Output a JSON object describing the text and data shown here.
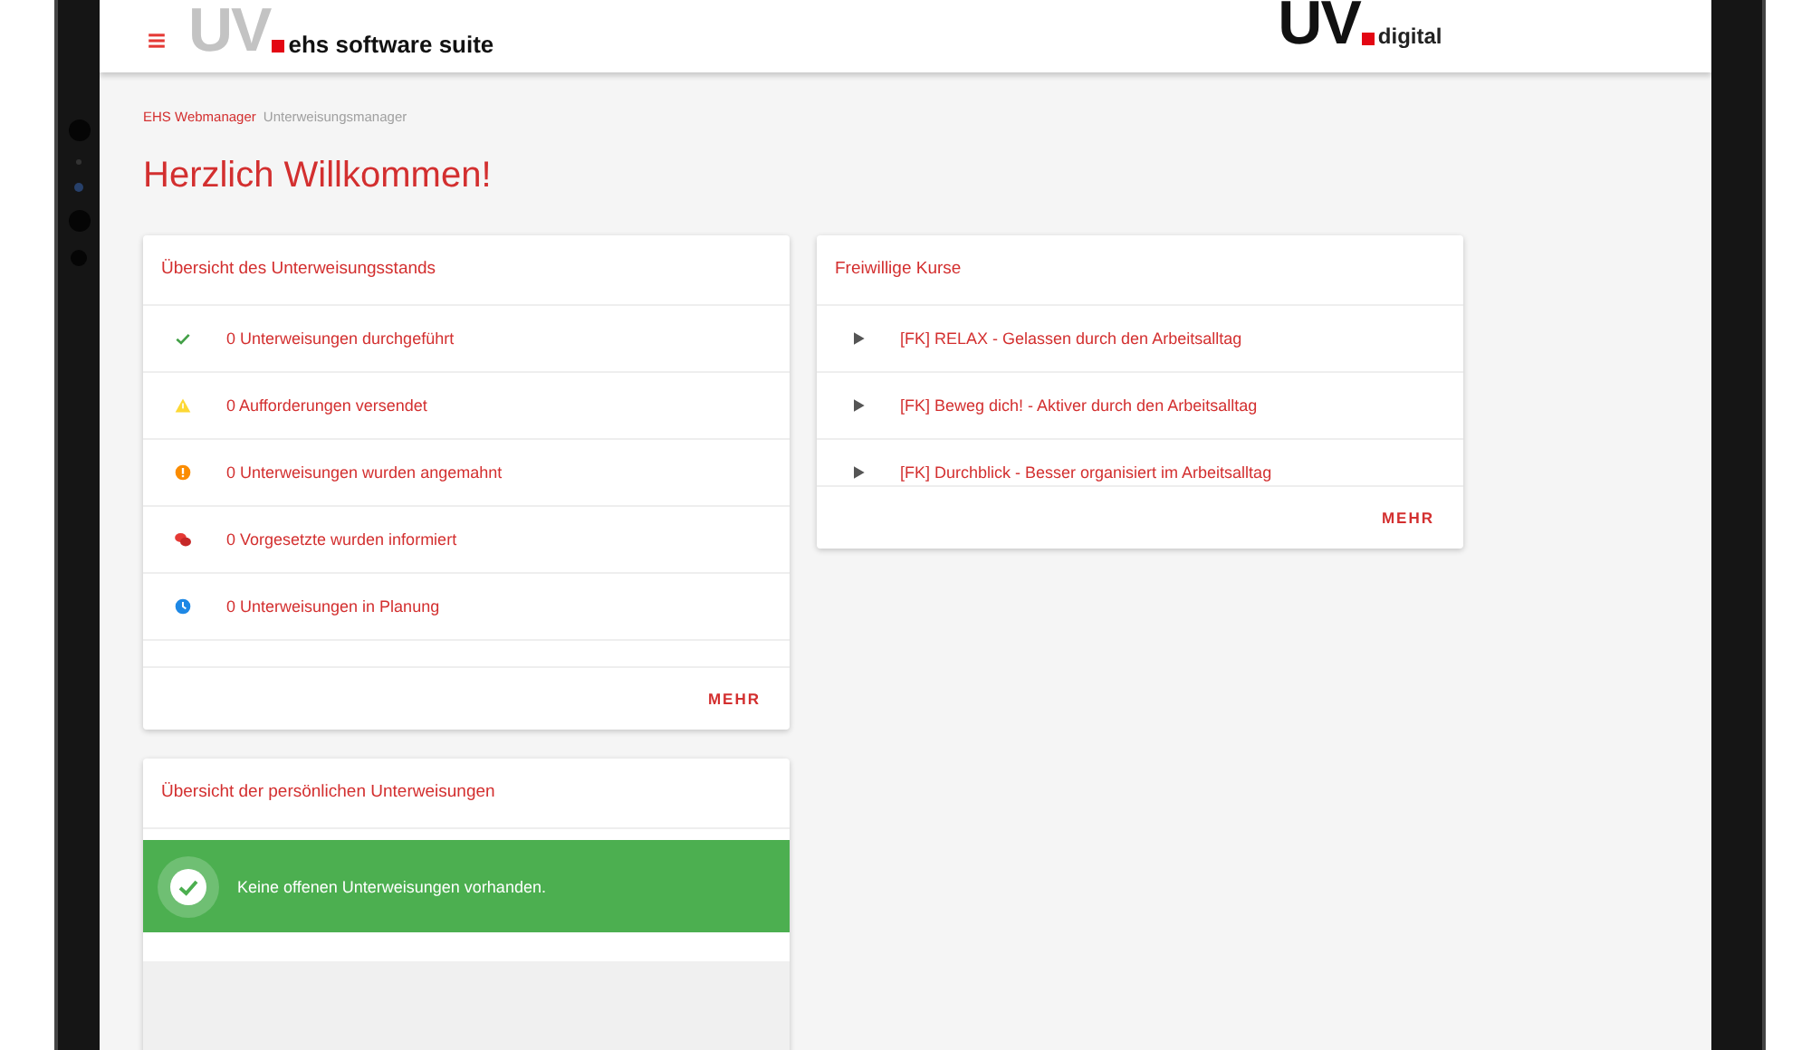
{
  "header": {
    "logo_left": "UV",
    "logo_left_suffix": "ehs software suite",
    "logo_right": "UV",
    "logo_right_suffix": "digital"
  },
  "breadcrumb": [
    {
      "label": "EHS Webmanager",
      "selected": false
    },
    {
      "label": "Unterweisungsmanager",
      "selected": true
    }
  ],
  "title": "Herzlich Willkommen!",
  "status_card": {
    "title": "Übersicht des Unterweisungsstands",
    "items": [
      {
        "kind": "done",
        "label": "0 Unterweisungen durchgeführt"
      },
      {
        "kind": "warning",
        "label": "0 Aufforderungen versendet"
      },
      {
        "kind": "reminder",
        "label": "0 Unterweisungen wurden angemahnt"
      },
      {
        "kind": "informed",
        "label": "0 Vorgesetzte wurden informiert"
      },
      {
        "kind": "planned",
        "label": "0 Unterweisungen in Planung"
      }
    ],
    "more": "MEHR"
  },
  "courses_card": {
    "title": "Freiwillige Kurse",
    "items": [
      "[FK] RELAX - Gelassen durch den Arbeitsalltag",
      "[FK] Beweg dich! - Aktiver durch den Arbeitsalltag",
      "[FK] Durchblick - Besser organisiert im Arbeitsalltag"
    ],
    "more": "MEHR"
  },
  "personal_card": {
    "title": "Übersicht der persönlichen Unterweisungen",
    "message": "Keine offenen Unterweisungen vorhanden."
  }
}
